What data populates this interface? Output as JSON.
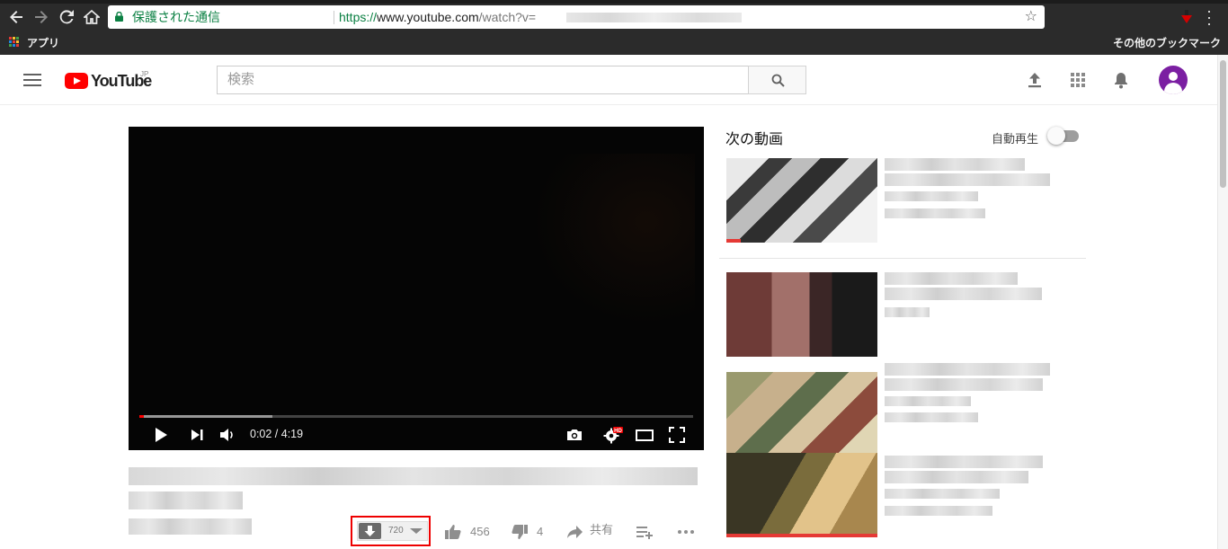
{
  "browser": {
    "security_label": "保護された通信",
    "url_scheme": "https://",
    "url_host": "www.youtube.com",
    "url_path": "/watch?v=",
    "bookmarks": {
      "apps_label": "アプリ",
      "other_label": "その他のブックマーク"
    }
  },
  "masthead": {
    "logo_text": "YouTube",
    "logo_region": "JP",
    "search_placeholder": "検索"
  },
  "player": {
    "current_time": "0:02",
    "duration": "4:19",
    "time_display": "0:02 / 4:19",
    "progress_played_fraction": 0.008,
    "progress_loaded_fraction": 0.24,
    "hd_badge": "HD"
  },
  "actions": {
    "download_quality": "720",
    "like_count": "456",
    "dislike_count": "4",
    "share_label": "共有"
  },
  "sidebar": {
    "up_next_title": "次の動画",
    "autoplay_label": "自動再生",
    "autoplay_on": false
  },
  "colors": {
    "brand_red": "#ff0000",
    "secure_green": "#0b8043",
    "highlight_box": "#ee0000",
    "avatar": "#7b1fa2"
  }
}
